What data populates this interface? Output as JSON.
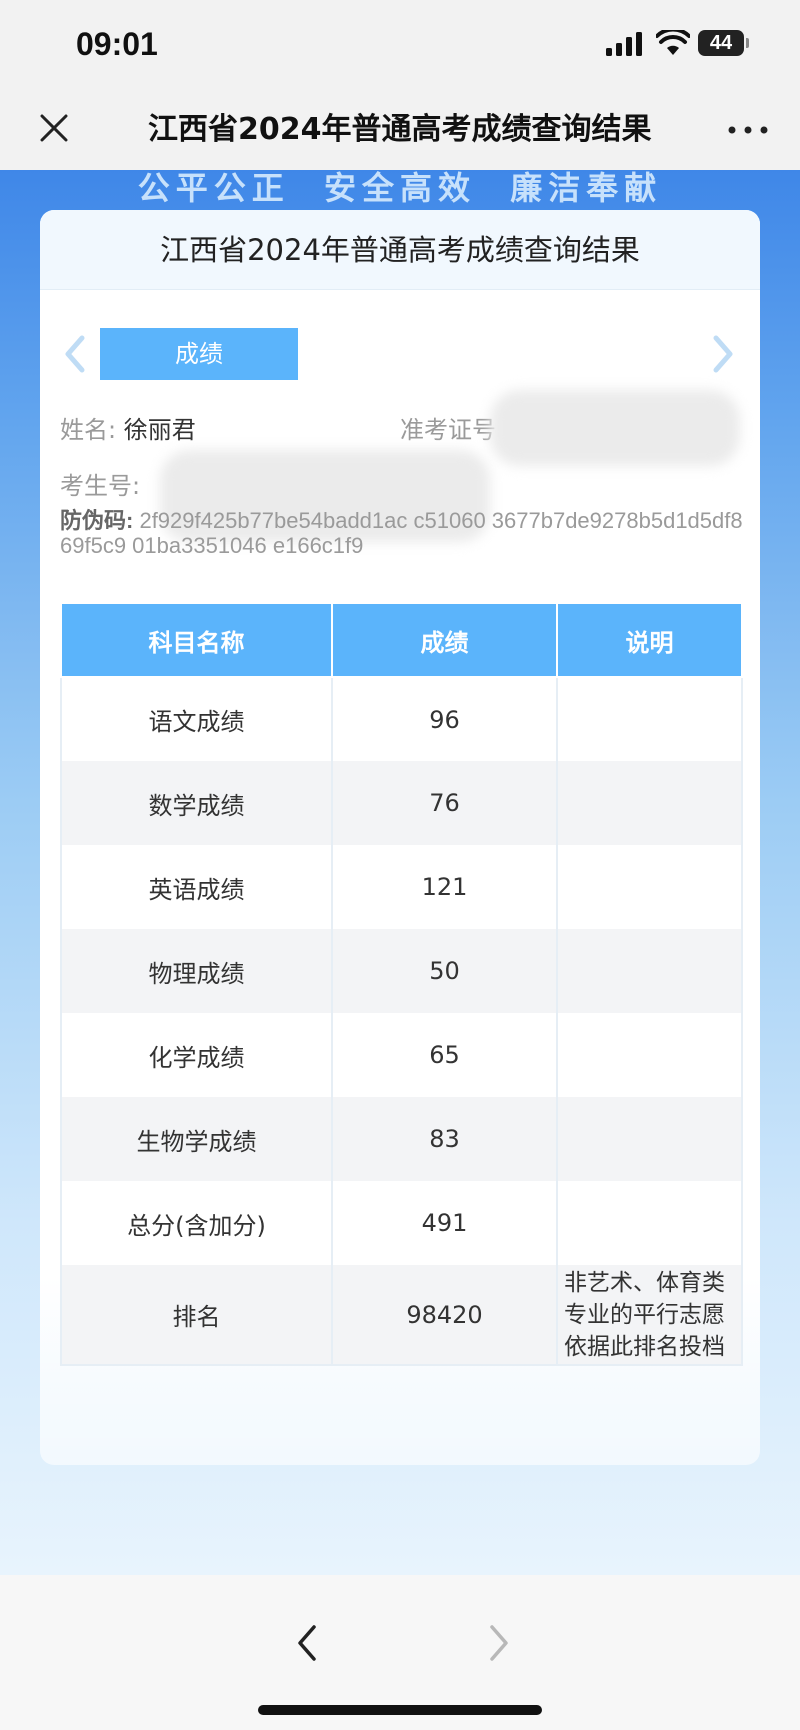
{
  "status_bar": {
    "time": "09:01",
    "battery": "44"
  },
  "nav": {
    "title": "江西省2024年普通高考成绩查询结果"
  },
  "banner": {
    "slogan": "公平公正  安全高效  廉洁奉献"
  },
  "card": {
    "header": "江西省2024年普通高考成绩查询结果",
    "tab_label": "成绩",
    "name_label": "姓名:",
    "name_value": "徐丽君",
    "exam_no_label": "准考证号",
    "student_no_label": "考生号:",
    "anti_fake_label": "防伪码:",
    "anti_fake_visible": "2f929f425b77be54badd1ac c51060 3677b7de9278b5d1d5df869f5c9 01ba3351046 e166c1f9"
  },
  "table": {
    "headers": [
      "科目名称",
      "成绩",
      "说明"
    ],
    "rows": [
      {
        "subject": "语文成绩",
        "score": "96",
        "note": ""
      },
      {
        "subject": "数学成绩",
        "score": "76",
        "note": ""
      },
      {
        "subject": "英语成绩",
        "score": "121",
        "note": ""
      },
      {
        "subject": "物理成绩",
        "score": "50",
        "note": ""
      },
      {
        "subject": "化学成绩",
        "score": "65",
        "note": ""
      },
      {
        "subject": "生物学成绩",
        "score": "83",
        "note": ""
      },
      {
        "subject": "总分(含加分)",
        "score": "491",
        "note": ""
      },
      {
        "subject": "排名",
        "score": "98420",
        "note": "非艺术、体育类专业的平行志愿依据此排名投档"
      }
    ]
  },
  "colors": {
    "accent": "#5bb4fb",
    "header_blue": "#3f87e8"
  },
  "icons": [
    "close-icon",
    "more-icon",
    "chevron-left-icon",
    "chevron-right-icon",
    "signal-icon",
    "wifi-icon",
    "battery-icon"
  ]
}
